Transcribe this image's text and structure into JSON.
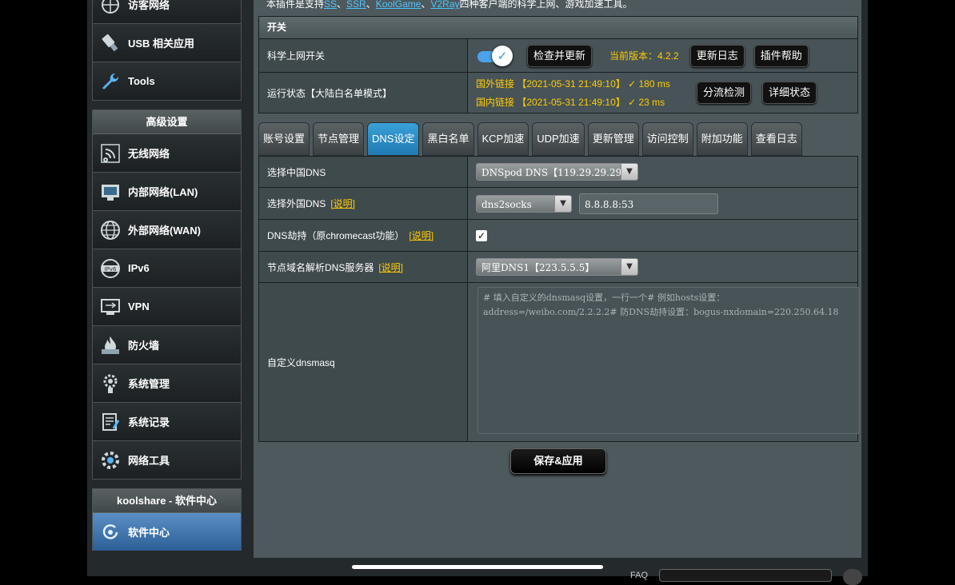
{
  "sidebar": {
    "top_items": [
      {
        "label": "访客网络",
        "icon": "guest-network-icon"
      },
      {
        "label": "USB 相关应用",
        "icon": "usb-icon"
      },
      {
        "label": "Tools",
        "icon": "wrench-icon"
      }
    ],
    "advanced_title": "高级设置",
    "advanced_items": [
      {
        "label": "无线网络",
        "icon": "wireless-icon"
      },
      {
        "label": "内部网络(LAN)",
        "icon": "lan-icon"
      },
      {
        "label": "外部网络(WAN)",
        "icon": "wan-globe-icon"
      },
      {
        "label": "IPv6",
        "icon": "ipv6-icon"
      },
      {
        "label": "VPN",
        "icon": "vpn-icon"
      },
      {
        "label": "防火墙",
        "icon": "firewall-icon"
      },
      {
        "label": "系统管理",
        "icon": "system-admin-icon"
      },
      {
        "label": "系统记录",
        "icon": "system-log-icon"
      },
      {
        "label": "网络工具",
        "icon": "network-tools-icon"
      }
    ],
    "koolshare_title": "koolshare - 软件中心",
    "software_center": "软件中心"
  },
  "intro": {
    "prefix": "本插件是支持",
    "links": [
      "SS",
      "SSR",
      "KoolGame",
      "V2Ray"
    ],
    "sep": "、",
    "suffix": "四种客户端的科学上网、游戏加速工具。"
  },
  "switch_section": {
    "header": "开关",
    "toggle_label": "科学上网开关",
    "toggle_on": true,
    "check_update": "检查并更新",
    "version_text": "当前版本：4.2.2",
    "changelog": "更新日志",
    "plugin_help": "插件帮助",
    "status_label": "运行状态【大陆白名单模式】",
    "status_foreign": "国外链接 【2021-05-31 21:49:10】 ✓  180 ms",
    "status_domestic": "国内链接 【2021-05-31 21:49:10】 ✓  23 ms",
    "split_check": "分流检测",
    "detail_status": "详细状态"
  },
  "tabs": [
    "账号设置",
    "节点管理",
    "DNS设定",
    "黑白名单",
    "KCP加速",
    "UDP加速",
    "更新管理",
    "访问控制",
    "附加功能",
    "查看日志"
  ],
  "active_tab": "DNS设定",
  "dns": {
    "cn_dns_label": "选择中国DNS",
    "cn_dns_value": "DNSpod DNS【119.29.29.29】",
    "foreign_dns_label": "选择外国DNS",
    "foreign_dns_value": "dns2socks",
    "foreign_dns_server": "8.8.8.8:53",
    "hijack_label": "DNS劫持（原chromecast功能）",
    "hijack_checked": true,
    "node_dns_label": "节点域名解析DNS服务器",
    "node_dns_value": "阿里DNS1【223.5.5.5】",
    "explain": "[说明]",
    "custom_label": "自定义dnsmasq",
    "custom_placeholder": "# 填入自定义的dnsmasq设置，一行一个# 例如hosts设置：address=/weibo.com/2.2.2.2# 防DNS劫持设置：bogus-nxdomain=220.250.64.18"
  },
  "save_button": "保存&应用",
  "footer": {
    "faq": "FAQ"
  },
  "colors": {
    "accent_tab": "#2b8ccc",
    "link_yellow": "#ffcc00",
    "intro_link": "#4ec5ff"
  }
}
